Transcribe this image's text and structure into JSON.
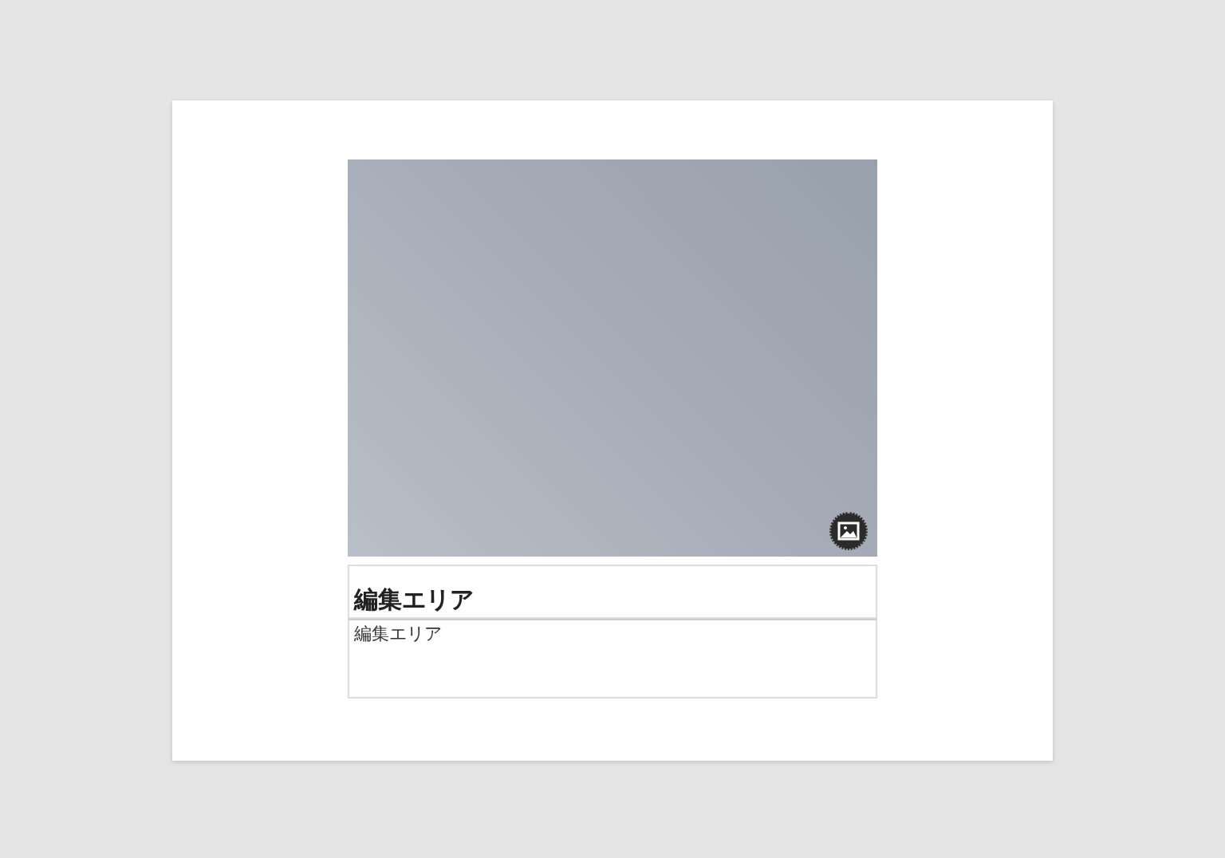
{
  "image_block": {
    "kind": "placeholder"
  },
  "heading": "編集エリア",
  "body": "編集エリア"
}
